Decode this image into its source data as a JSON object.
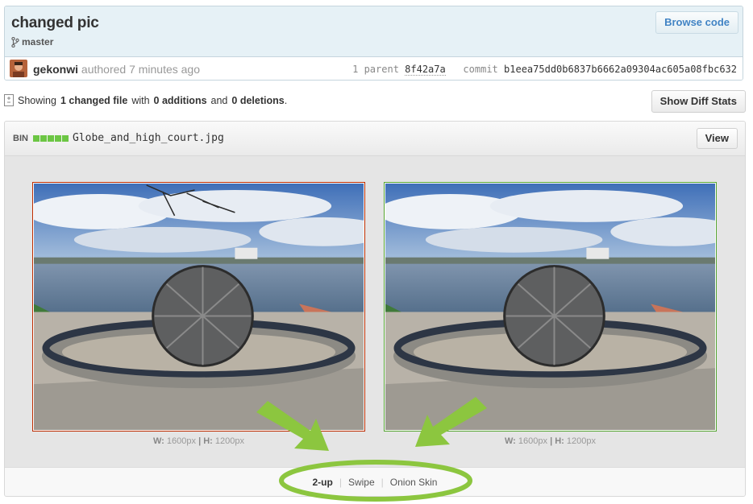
{
  "commit": {
    "title": "changed pic",
    "branch": "master",
    "browse_label": "Browse code",
    "author": "gekonwi",
    "authored_text": "authored 7 minutes ago",
    "parent_label": "1 parent",
    "parent_sha": "8f42a7a",
    "commit_label": "commit",
    "commit_sha": "b1eea75dd0b6837b6662a09304ac605a08fbc632"
  },
  "summary": {
    "showing": "Showing",
    "changed": "1 changed file",
    "with": "with",
    "additions": "0 additions",
    "and": "and",
    "deletions": "0 deletions",
    "period": ".",
    "diff_stats_label": "Show Diff Stats"
  },
  "file": {
    "bin_label": "BIN",
    "name": "Globe_and_high_court.jpg",
    "view_label": "View",
    "left_dims": {
      "w_label": "W:",
      "w_value": "1600px",
      "sep": "|",
      "h_label": "H:",
      "h_value": "1200px"
    },
    "right_dims": {
      "w_label": "W:",
      "w_value": "1600px",
      "sep": "|",
      "h_label": "H:",
      "h_value": "1200px"
    }
  },
  "view_modes": [
    {
      "label": "2-up",
      "active": true
    },
    {
      "label": "Swipe",
      "active": false
    },
    {
      "label": "Onion Skin",
      "active": false
    }
  ],
  "colors": {
    "deleted_border": "#bd2c00",
    "added_border": "#55a532",
    "annotation": "#8cc63f",
    "link": "#4183c4"
  }
}
